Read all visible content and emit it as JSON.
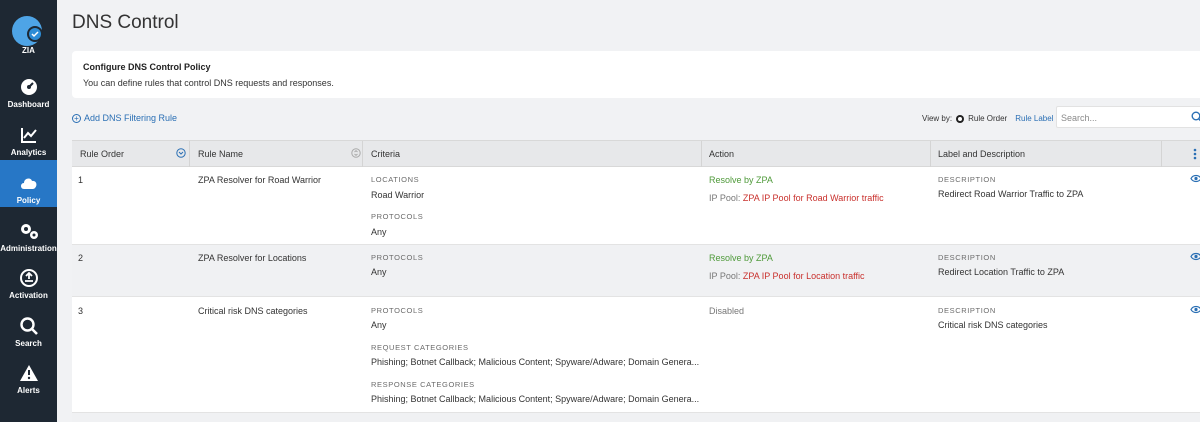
{
  "sidebar": {
    "logo_label": "ZIA",
    "items": [
      {
        "label": "Dashboard",
        "icon": "dashboard-icon"
      },
      {
        "label": "Analytics",
        "icon": "analytics-icon"
      },
      {
        "label": "Policy",
        "icon": "cloud-icon",
        "active": true
      },
      {
        "label": "Administration",
        "icon": "gears-icon"
      },
      {
        "label": "Activation",
        "icon": "activation-icon"
      },
      {
        "label": "Search",
        "icon": "search-icon"
      },
      {
        "label": "Alerts",
        "icon": "alert-icon"
      }
    ]
  },
  "page": {
    "title": "DNS Control",
    "card_title": "Configure DNS Control Policy",
    "card_text": "You can define rules that control DNS requests and responses.",
    "add_rule": "Add DNS Filtering Rule",
    "view_by_label": "View by:",
    "view_by_selected": "Rule Order",
    "view_by_other": "Rule Label",
    "search_placeholder": "Search..."
  },
  "table": {
    "headers": [
      "Rule Order",
      "Rule Name",
      "Criteria",
      "Action",
      "Label and Description"
    ],
    "rows": [
      {
        "order": "1",
        "name": "ZPA Resolver for Road Warrior",
        "criteria": [
          {
            "label": "LOCATIONS",
            "value": "Road Warrior"
          },
          {
            "label": "PROTOCOLS",
            "value": "Any"
          }
        ],
        "action": "Resolve by ZPA",
        "ip_pool_label": "IP Pool:",
        "ip_pool": "ZPA IP Pool for Road Warrior traffic",
        "desc_label": "DESCRIPTION",
        "desc": "Redirect Road Warrior Traffic to ZPA"
      },
      {
        "order": "2",
        "name": "ZPA Resolver for Locations",
        "criteria": [
          {
            "label": "PROTOCOLS",
            "value": "Any"
          }
        ],
        "action": "Resolve by ZPA",
        "ip_pool_label": "IP Pool:",
        "ip_pool": "ZPA IP Pool for Location traffic",
        "desc_label": "DESCRIPTION",
        "desc": "Redirect Location Traffic to ZPA"
      },
      {
        "order": "3",
        "name": "Critical risk DNS categories",
        "criteria": [
          {
            "label": "PROTOCOLS",
            "value": "Any"
          },
          {
            "label": "REQUEST CATEGORIES",
            "value": "Phishing; Botnet Callback; Malicious Content; Spyware/Adware; Domain Genera..."
          },
          {
            "label": "RESPONSE CATEGORIES",
            "value": "Phishing; Botnet Callback; Malicious Content; Spyware/Adware; Domain Genera..."
          }
        ],
        "action": "Disabled",
        "desc_label": "DESCRIPTION",
        "desc": "Critical risk DNS categories"
      }
    ]
  },
  "colors": {
    "sidebar_bg": "#1e2833",
    "active_nav": "#2777c6",
    "link": "#2a6fb4",
    "action_green": "#4f9a3a",
    "pool_red": "#c9302c"
  }
}
